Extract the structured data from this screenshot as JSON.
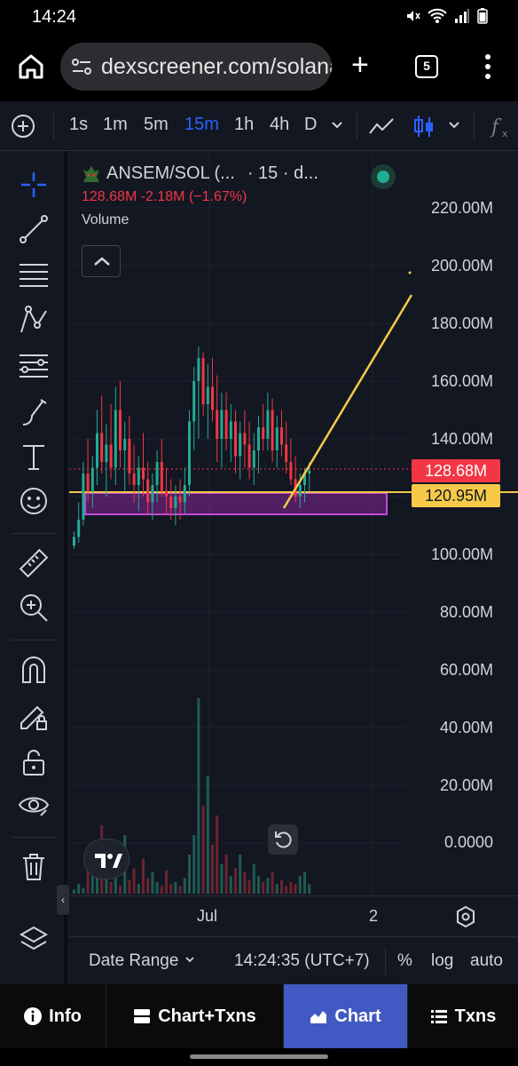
{
  "status_bar": {
    "time": "14:24",
    "icons": [
      "mute-icon",
      "wifi-icon",
      "signal-icon",
      "battery-icon"
    ]
  },
  "browser": {
    "url": "dexscreener.com/solana",
    "tab_count": "5"
  },
  "toolbar": {
    "intervals": [
      "1s",
      "1m",
      "5m",
      "15m",
      "1h",
      "4h",
      "D"
    ],
    "active_interval": "15m"
  },
  "legend": {
    "symbol": "ANSEM/SOL (...",
    "timeframe": "· 15 · d...",
    "ohlc_change": "128.68M  -2.18M (−1.67%)",
    "volume_label": "Volume"
  },
  "price_axis": {
    "labels": [
      "220.00M",
      "200.00M",
      "180.00M",
      "160.00M",
      "140.00M",
      "100.00M",
      "80.00M",
      "60.00M",
      "40.00M",
      "20.00M",
      "0.0000"
    ],
    "current_price": "128.68M",
    "line_price": "120.95M"
  },
  "time_axis": {
    "labels": [
      "Jul",
      "2"
    ]
  },
  "bottom_bar": {
    "date_range": "Date Range",
    "clock": "14:24:35 (UTC+7)",
    "percent": "%",
    "log": "log",
    "auto": "auto"
  },
  "nav": {
    "info": "Info",
    "chart_txns": "Chart+Txns",
    "chart": "Chart",
    "txns": "Txns"
  },
  "colors": {
    "up": "#22ab94",
    "down": "#f23645",
    "accent": "#2962ff",
    "trendline": "#f7c948",
    "zone": "#9c27b0"
  },
  "chart_data": {
    "type": "candlestick",
    "ylim": [
      100,
      220
    ],
    "candles": [
      [
        103,
        108,
        102,
        106
      ],
      [
        106,
        118,
        104,
        112
      ],
      [
        112,
        132,
        110,
        128
      ],
      [
        128,
        140,
        118,
        122
      ],
      [
        122,
        134,
        116,
        130
      ],
      [
        130,
        150,
        124,
        142
      ],
      [
        142,
        155,
        128,
        132
      ],
      [
        132,
        145,
        120,
        138
      ],
      [
        138,
        152,
        126,
        130
      ],
      [
        130,
        158,
        124,
        150
      ],
      [
        150,
        160,
        130,
        136
      ],
      [
        136,
        146,
        122,
        140
      ],
      [
        140,
        148,
        124,
        128
      ],
      [
        128,
        138,
        118,
        124
      ],
      [
        124,
        134,
        115,
        130
      ],
      [
        130,
        142,
        120,
        126
      ],
      [
        126,
        132,
        114,
        118
      ],
      [
        118,
        128,
        112,
        124
      ],
      [
        124,
        136,
        118,
        132
      ],
      [
        132,
        140,
        120,
        122
      ],
      [
        122,
        130,
        114,
        120
      ],
      [
        120,
        126,
        112,
        116
      ],
      [
        116,
        124,
        110,
        120
      ],
      [
        120,
        126,
        112,
        118
      ],
      [
        118,
        130,
        114,
        124
      ],
      [
        124,
        150,
        120,
        146
      ],
      [
        146,
        165,
        136,
        160
      ],
      [
        160,
        172,
        140,
        168
      ],
      [
        168,
        170,
        148,
        152
      ],
      [
        152,
        166,
        140,
        158
      ],
      [
        158,
        168,
        146,
        150
      ],
      [
        150,
        162,
        132,
        140
      ],
      [
        140,
        156,
        130,
        150
      ],
      [
        150,
        156,
        136,
        140
      ],
      [
        140,
        152,
        132,
        146
      ],
      [
        146,
        150,
        128,
        134
      ],
      [
        134,
        146,
        126,
        142
      ],
      [
        142,
        150,
        130,
        138
      ],
      [
        138,
        146,
        126,
        130
      ],
      [
        130,
        142,
        124,
        136
      ],
      [
        136,
        148,
        128,
        144
      ],
      [
        144,
        152,
        136,
        140
      ],
      [
        140,
        156,
        136,
        150
      ],
      [
        150,
        154,
        132,
        136
      ],
      [
        136,
        148,
        130,
        144
      ],
      [
        144,
        150,
        134,
        138
      ],
      [
        138,
        146,
        128,
        132
      ],
      [
        132,
        140,
        124,
        126
      ],
      [
        126,
        134,
        118,
        120
      ],
      [
        120,
        128,
        116,
        124
      ],
      [
        124,
        130,
        118,
        128
      ],
      [
        128,
        132,
        122,
        129
      ]
    ]
  }
}
